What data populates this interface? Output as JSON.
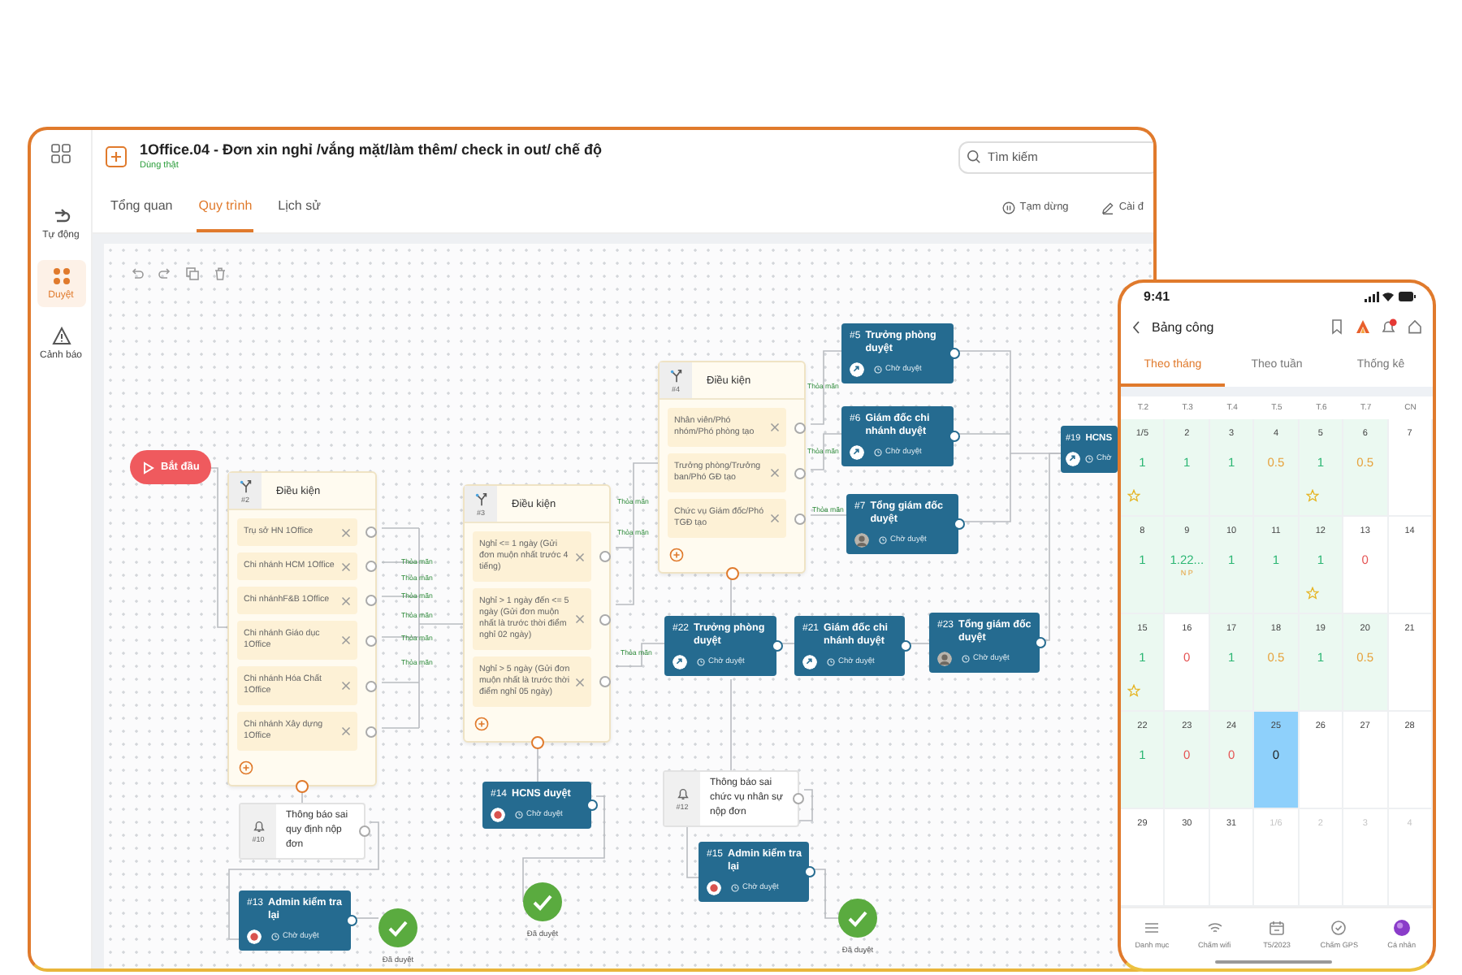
{
  "desktop": {
    "sidebar": [
      {
        "label": "Tự động",
        "selected": false
      },
      {
        "label": "Duyệt",
        "selected": true
      },
      {
        "label": "Cảnh báo",
        "selected": false
      }
    ],
    "header": {
      "title": "1Office.04 - Đơn xin nghỉ /vắng mặt/làm thêm/ check in out/ chế độ",
      "status": "Dùng thật",
      "search_placeholder": "Tìm kiếm"
    },
    "tabs": [
      {
        "label": "Tổng quan",
        "selected": false
      },
      {
        "label": "Quy trình",
        "selected": true
      },
      {
        "label": "Lịch sử",
        "selected": false
      }
    ],
    "actions": [
      "Tạm dừng",
      "Cài đ"
    ],
    "flow": {
      "nodes": [
        {
          "kind": "start",
          "label": "Bắt đầu"
        },
        {
          "kind": "condition",
          "number": "#2",
          "title": "Điều kiện",
          "options": [
            "Trụ sở HN 1Office",
            "Chi nhánh HCM 1Office",
            "Chi nhánhF&B 1Office",
            "Chi nhánh Giáo dục 1Office",
            "Chi nhánh Hóa Chất 1Office",
            "Chi nhánh Xây dựng 1Office"
          ]
        },
        {
          "kind": "notify",
          "number": "#10",
          "text": "Thông báo sai quy định nộp đơn"
        },
        {
          "kind": "approval",
          "number": "#13",
          "title": "Admin kiểm tra lại",
          "status": "Chờ duyệt",
          "assignee": {
            "kind": "admin"
          }
        },
        {
          "kind": "done",
          "label": "Đã duyệt"
        },
        {
          "kind": "condition",
          "number": "#3",
          "title": "Điều kiện",
          "options": [
            "Nghỉ <= 1 ngày (Gửi đơn muộn nhất trước 4 tiếng)",
            "Nghỉ > 1 ngày đến <= 5 ngày (Gửi đơn muộn nhất là trước thời điểm nghỉ 02 ngày)",
            "Nghỉ > 5 ngày (Gửi đơn muộn nhất là trước thời điểm nghỉ 05 ngày)"
          ]
        },
        {
          "kind": "approval",
          "number": "#14",
          "title": "HCNS duyệt",
          "status": "Chờ duyệt",
          "assignee": {
            "kind": "admin"
          }
        },
        {
          "kind": "done",
          "label": "Đã duyệt"
        },
        {
          "kind": "condition",
          "number": "#4",
          "title": "Điều kiện",
          "options": [
            "Nhân viên/Phó nhóm/Phó phòng tạo",
            "Trưởng phòng/Trưởng ban/Phó GĐ tạo",
            "Chức vụ Giám đốc/Phó TGĐ tạo"
          ]
        },
        {
          "kind": "approval",
          "number": "#5",
          "title": "Trưởng phòng duyệt",
          "status": "Chờ duyệt",
          "assignee": {
            "kind": "role"
          }
        },
        {
          "kind": "approval",
          "number": "#6",
          "title": "Giám đốc chi nhánh duyệt",
          "status": "Chờ duyệt",
          "assignee": {
            "kind": "role"
          }
        },
        {
          "kind": "approval",
          "number": "#7",
          "title": "Tổng giám đốc duyệt",
          "status": "Chờ duyệt",
          "assignee": {
            "kind": "person"
          }
        },
        {
          "kind": "approval",
          "number": "#19",
          "title": "HCNS",
          "status": "Chờ",
          "assignee": {
            "kind": "role"
          }
        },
        {
          "kind": "approval",
          "number": "#22",
          "title": "Trưởng phòng duyệt",
          "status": "Chờ duyệt",
          "assignee": {
            "kind": "role"
          }
        },
        {
          "kind": "approval",
          "number": "#21",
          "title": "Giám đốc chi nhánh duyệt",
          "status": "Chờ duyệt",
          "assignee": {
            "kind": "role"
          }
        },
        {
          "kind": "approval",
          "number": "#23",
          "title": "Tổng giám đốc duyệt",
          "status": "Chờ duyệt",
          "assignee": {
            "kind": "person"
          }
        },
        {
          "kind": "notify",
          "number": "#12",
          "text": "Thông báo sai chức vụ nhân sự nộp đơn"
        },
        {
          "kind": "approval",
          "number": "#15",
          "title": "Admin kiểm tra lại",
          "status": "Chờ duyệt",
          "assignee": {
            "kind": "admin"
          }
        },
        {
          "kind": "done",
          "label": "Đã duyệt"
        }
      ],
      "edge_labels": [
        "Thỏa mãn",
        "Thỏa mãn",
        "Thỏa mãn",
        "Thỏa mãn",
        "Thỏa mãn",
        "Thỏa mãn",
        "Thỏa mãn",
        "Thỏa mãn",
        "Thỏa mãn",
        "Thỏa mãn",
        "Thỏa mãn",
        "Thỏa mãn"
      ]
    }
  },
  "mobile": {
    "time": "9:41",
    "title": "Bảng công",
    "tabs": [
      {
        "label": "Theo tháng",
        "selected": true
      },
      {
        "label": "Theo tuần",
        "selected": false
      },
      {
        "label": "Thống kê",
        "selected": false
      }
    ],
    "weekdays": [
      "T.2",
      "T.3",
      "T.4",
      "T.5",
      "T.6",
      "T.7",
      "CN"
    ],
    "weeks": [
      [
        {
          "day": "1/5",
          "kind": "worked",
          "selected": false,
          "value": "1",
          "color": "#2bb673",
          "starred": true
        },
        {
          "day": "2",
          "kind": "worked",
          "selected": false,
          "value": "1",
          "color": "#2bb673",
          "starred": false
        },
        {
          "day": "3",
          "kind": "worked",
          "selected": false,
          "value": "1",
          "color": "#2bb673",
          "starred": false
        },
        {
          "day": "4",
          "kind": "worked",
          "selected": false,
          "value": "0.5",
          "color": "#e6a23c",
          "starred": false
        },
        {
          "day": "5",
          "kind": "worked",
          "selected": false,
          "value": "1",
          "color": "#2bb673",
          "starred": true
        },
        {
          "day": "6",
          "kind": "worked",
          "selected": false,
          "value": "0.5",
          "color": "#e6a23c",
          "starred": false
        },
        {
          "day": "7",
          "kind": "off",
          "selected": false,
          "starred": false
        }
      ],
      [
        {
          "day": "8",
          "kind": "worked",
          "selected": false,
          "value": "1",
          "color": "#2bb673",
          "starred": false
        },
        {
          "day": "9",
          "kind": "worked",
          "selected": false,
          "value": "1.22...",
          "color": "#2bb673",
          "note": "N P",
          "starred": false
        },
        {
          "day": "10",
          "kind": "worked",
          "selected": false,
          "value": "1",
          "color": "#2bb673",
          "starred": false
        },
        {
          "day": "11",
          "kind": "worked",
          "selected": false,
          "value": "1",
          "color": "#2bb673",
          "starred": false
        },
        {
          "day": "12",
          "kind": "worked",
          "selected": false,
          "value": "1",
          "color": "#2bb673",
          "starred": true
        },
        {
          "day": "13",
          "kind": "off",
          "selected": false,
          "value": "0",
          "color": "#e55353",
          "starred": false
        },
        {
          "day": "14",
          "kind": "off",
          "selected": false,
          "starred": false
        }
      ],
      [
        {
          "day": "15",
          "kind": "worked",
          "selected": false,
          "value": "1",
          "color": "#2bb673",
          "starred": true
        },
        {
          "day": "16",
          "kind": "off",
          "selected": false,
          "value": "0",
          "color": "#e55353",
          "starred": false
        },
        {
          "day": "17",
          "kind": "worked",
          "selected": false,
          "value": "1",
          "color": "#2bb673",
          "starred": false
        },
        {
          "day": "18",
          "kind": "worked",
          "selected": false,
          "value": "0.5",
          "color": "#e6a23c",
          "starred": false
        },
        {
          "day": "19",
          "kind": "worked",
          "selected": false,
          "value": "1",
          "color": "#2bb673",
          "starred": false
        },
        {
          "day": "20",
          "kind": "worked",
          "selected": false,
          "value": "0.5",
          "color": "#e6a23c",
          "starred": false
        },
        {
          "day": "21",
          "kind": "off",
          "selected": false,
          "starred": false
        }
      ],
      [
        {
          "day": "22",
          "kind": "worked",
          "selected": false,
          "value": "1",
          "color": "#2bb673",
          "starred": false
        },
        {
          "day": "23",
          "kind": "worked",
          "selected": false,
          "value": "0",
          "color": "#e55353",
          "starred": false
        },
        {
          "day": "24",
          "kind": "worked",
          "selected": false,
          "value": "0",
          "color": "#e55353",
          "starred": false
        },
        {
          "day": "25",
          "kind": "worked",
          "selected": true,
          "value": "0",
          "color": "#222222",
          "starred": false
        },
        {
          "day": "26",
          "kind": "off",
          "selected": false,
          "starred": false
        },
        {
          "day": "27",
          "kind": "off",
          "selected": false,
          "starred": false
        },
        {
          "day": "28",
          "kind": "off",
          "selected": false,
          "starred": false
        }
      ],
      [
        {
          "day": "29",
          "kind": "off",
          "selected": false,
          "starred": false
        },
        {
          "day": "30",
          "kind": "off",
          "selected": false,
          "starred": false
        },
        {
          "day": "31",
          "kind": "off",
          "selected": false,
          "starred": false
        },
        {
          "day": "1/6",
          "kind": "other",
          "selected": false,
          "starred": false
        },
        {
          "day": "2",
          "kind": "other",
          "selected": false,
          "starred": false
        },
        {
          "day": "3",
          "kind": "other",
          "selected": false,
          "starred": false
        },
        {
          "day": "4",
          "kind": "other",
          "selected": false,
          "starred": false
        }
      ]
    ],
    "nav": [
      "Danh mục",
      "Chấm wifi",
      "T5/2023",
      "Chấm GPS",
      "Cá nhân"
    ]
  }
}
